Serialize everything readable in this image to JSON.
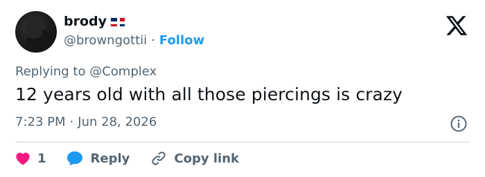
{
  "user": {
    "display_name": "brody",
    "handle": "@browngottii",
    "separator": "·",
    "follow_label": "Follow"
  },
  "tweet": {
    "replying_prefix": "Replying to",
    "replying_to": "@Complex",
    "text": "12 years old with all those piercings is crazy",
    "time": "7:23 PM",
    "date_separator": "·",
    "date": "Jun 28, 2026"
  },
  "actions": {
    "like_count": "1",
    "reply_label": "Reply",
    "copy_label": "Copy link"
  },
  "colors": {
    "accent": "#1d9bf0",
    "like": "#f91880",
    "text": "#0f1419",
    "muted": "#536471"
  },
  "icons": [
    "x-logo-icon",
    "flag-dominican-republic-icon",
    "info-icon",
    "heart-icon",
    "reply-bubble-icon",
    "link-icon"
  ]
}
